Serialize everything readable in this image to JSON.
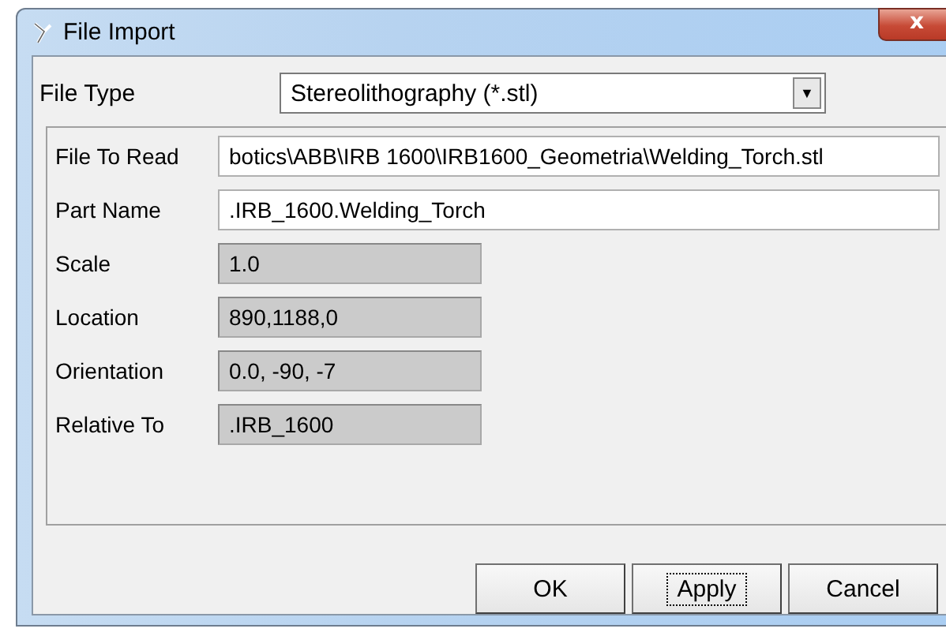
{
  "window": {
    "title": "File Import",
    "close": "x"
  },
  "file_type": {
    "label": "File Type",
    "value": "Stereolithography (*.stl)",
    "arrow": "▼"
  },
  "fields": [
    {
      "label": "File To Read",
      "value": "botics\\ABB\\IRB 1600\\IRB1600_Geometria\\Welding_Torch.stl",
      "readonly": false
    },
    {
      "label": "Part Name",
      "value": ".IRB_1600.Welding_Torch",
      "readonly": false
    },
    {
      "label": "Scale",
      "value": "1.0",
      "readonly": true
    },
    {
      "label": "Location",
      "value": "890,1188,0",
      "readonly": true
    },
    {
      "label": "Orientation",
      "value": "0.0, -90, -7",
      "readonly": true
    },
    {
      "label": "Relative To",
      "value": ".IRB_1600",
      "readonly": true
    }
  ],
  "buttons": [
    {
      "label": "OK",
      "focused": false
    },
    {
      "label": "Apply",
      "focused": true
    },
    {
      "label": "Cancel",
      "focused": false
    }
  ]
}
